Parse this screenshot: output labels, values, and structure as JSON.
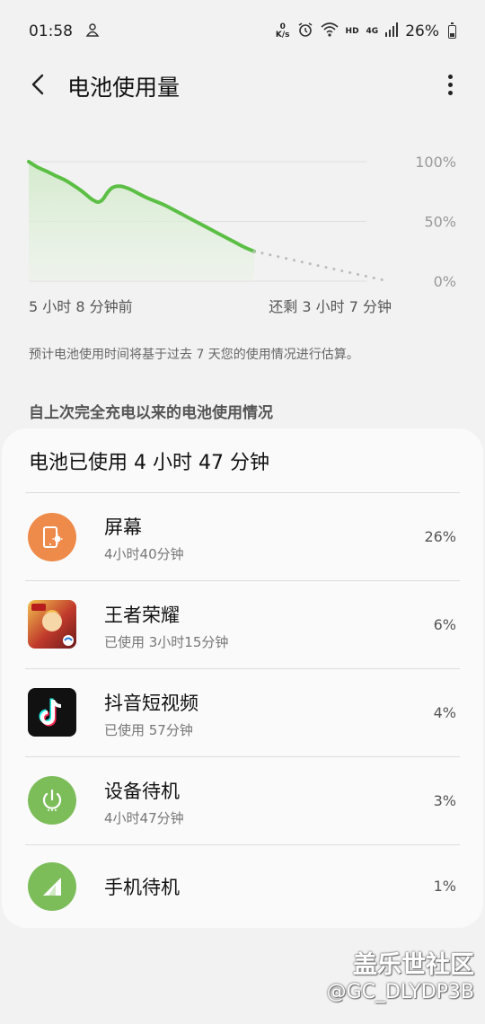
{
  "status_bar": {
    "time": "01:58",
    "net_speed_value": "0",
    "net_speed_unit": "K/s",
    "hd": "HD",
    "network": "4G",
    "battery": "26%"
  },
  "header": {
    "title": "电池使用量"
  },
  "chart_data": {
    "type": "line",
    "y_ticks": [
      "100%",
      "50%",
      "0%"
    ],
    "ylim": [
      0,
      100
    ],
    "x_start_label": "5 小时 8 分钟前",
    "x_end_label": "还剩 3 小时 7 分钟",
    "series": [
      {
        "style": "solid",
        "color": "#5cbf45",
        "values": [
          100,
          95,
          92,
          88,
          85,
          80,
          75,
          68,
          65,
          78,
          80,
          78,
          74,
          70,
          67,
          64,
          60,
          56,
          52,
          48,
          44,
          40,
          36,
          32,
          28,
          25
        ]
      },
      {
        "style": "dotted",
        "color": "#bbbbbb",
        "values": [
          25,
          20,
          15,
          10,
          5,
          0
        ]
      }
    ]
  },
  "note": "预计电池使用时间将基于过去 7 天您的使用情况进行估算。",
  "section_title": "自上次完全充电以来的电池使用情况",
  "card": {
    "title": "电池已使用 4 小时 47 分钟",
    "items": [
      {
        "name": "屏幕",
        "sub": "4小时40分钟",
        "pct": "26%",
        "icon": "screen-icon",
        "color": "#ee8a4a"
      },
      {
        "name": "王者荣耀",
        "sub": "已使用 3小时15分钟",
        "pct": "6%",
        "icon": "honor-of-kings-app-icon",
        "color": "#c0392b"
      },
      {
        "name": "抖音短视频",
        "sub": "已使用 57分钟",
        "pct": "4%",
        "icon": "douyin-app-icon",
        "color": "#111111"
      },
      {
        "name": "设备待机",
        "sub": "4小时47分钟",
        "pct": "3%",
        "icon": "power-icon",
        "color": "#7cbd5a"
      },
      {
        "name": "手机待机",
        "sub": "",
        "pct": "1%",
        "icon": "signal-icon",
        "color": "#7cbd5a"
      }
    ]
  },
  "watermark": {
    "line1": "盖乐世社区",
    "line2": "@GC_DLYDP3B"
  }
}
